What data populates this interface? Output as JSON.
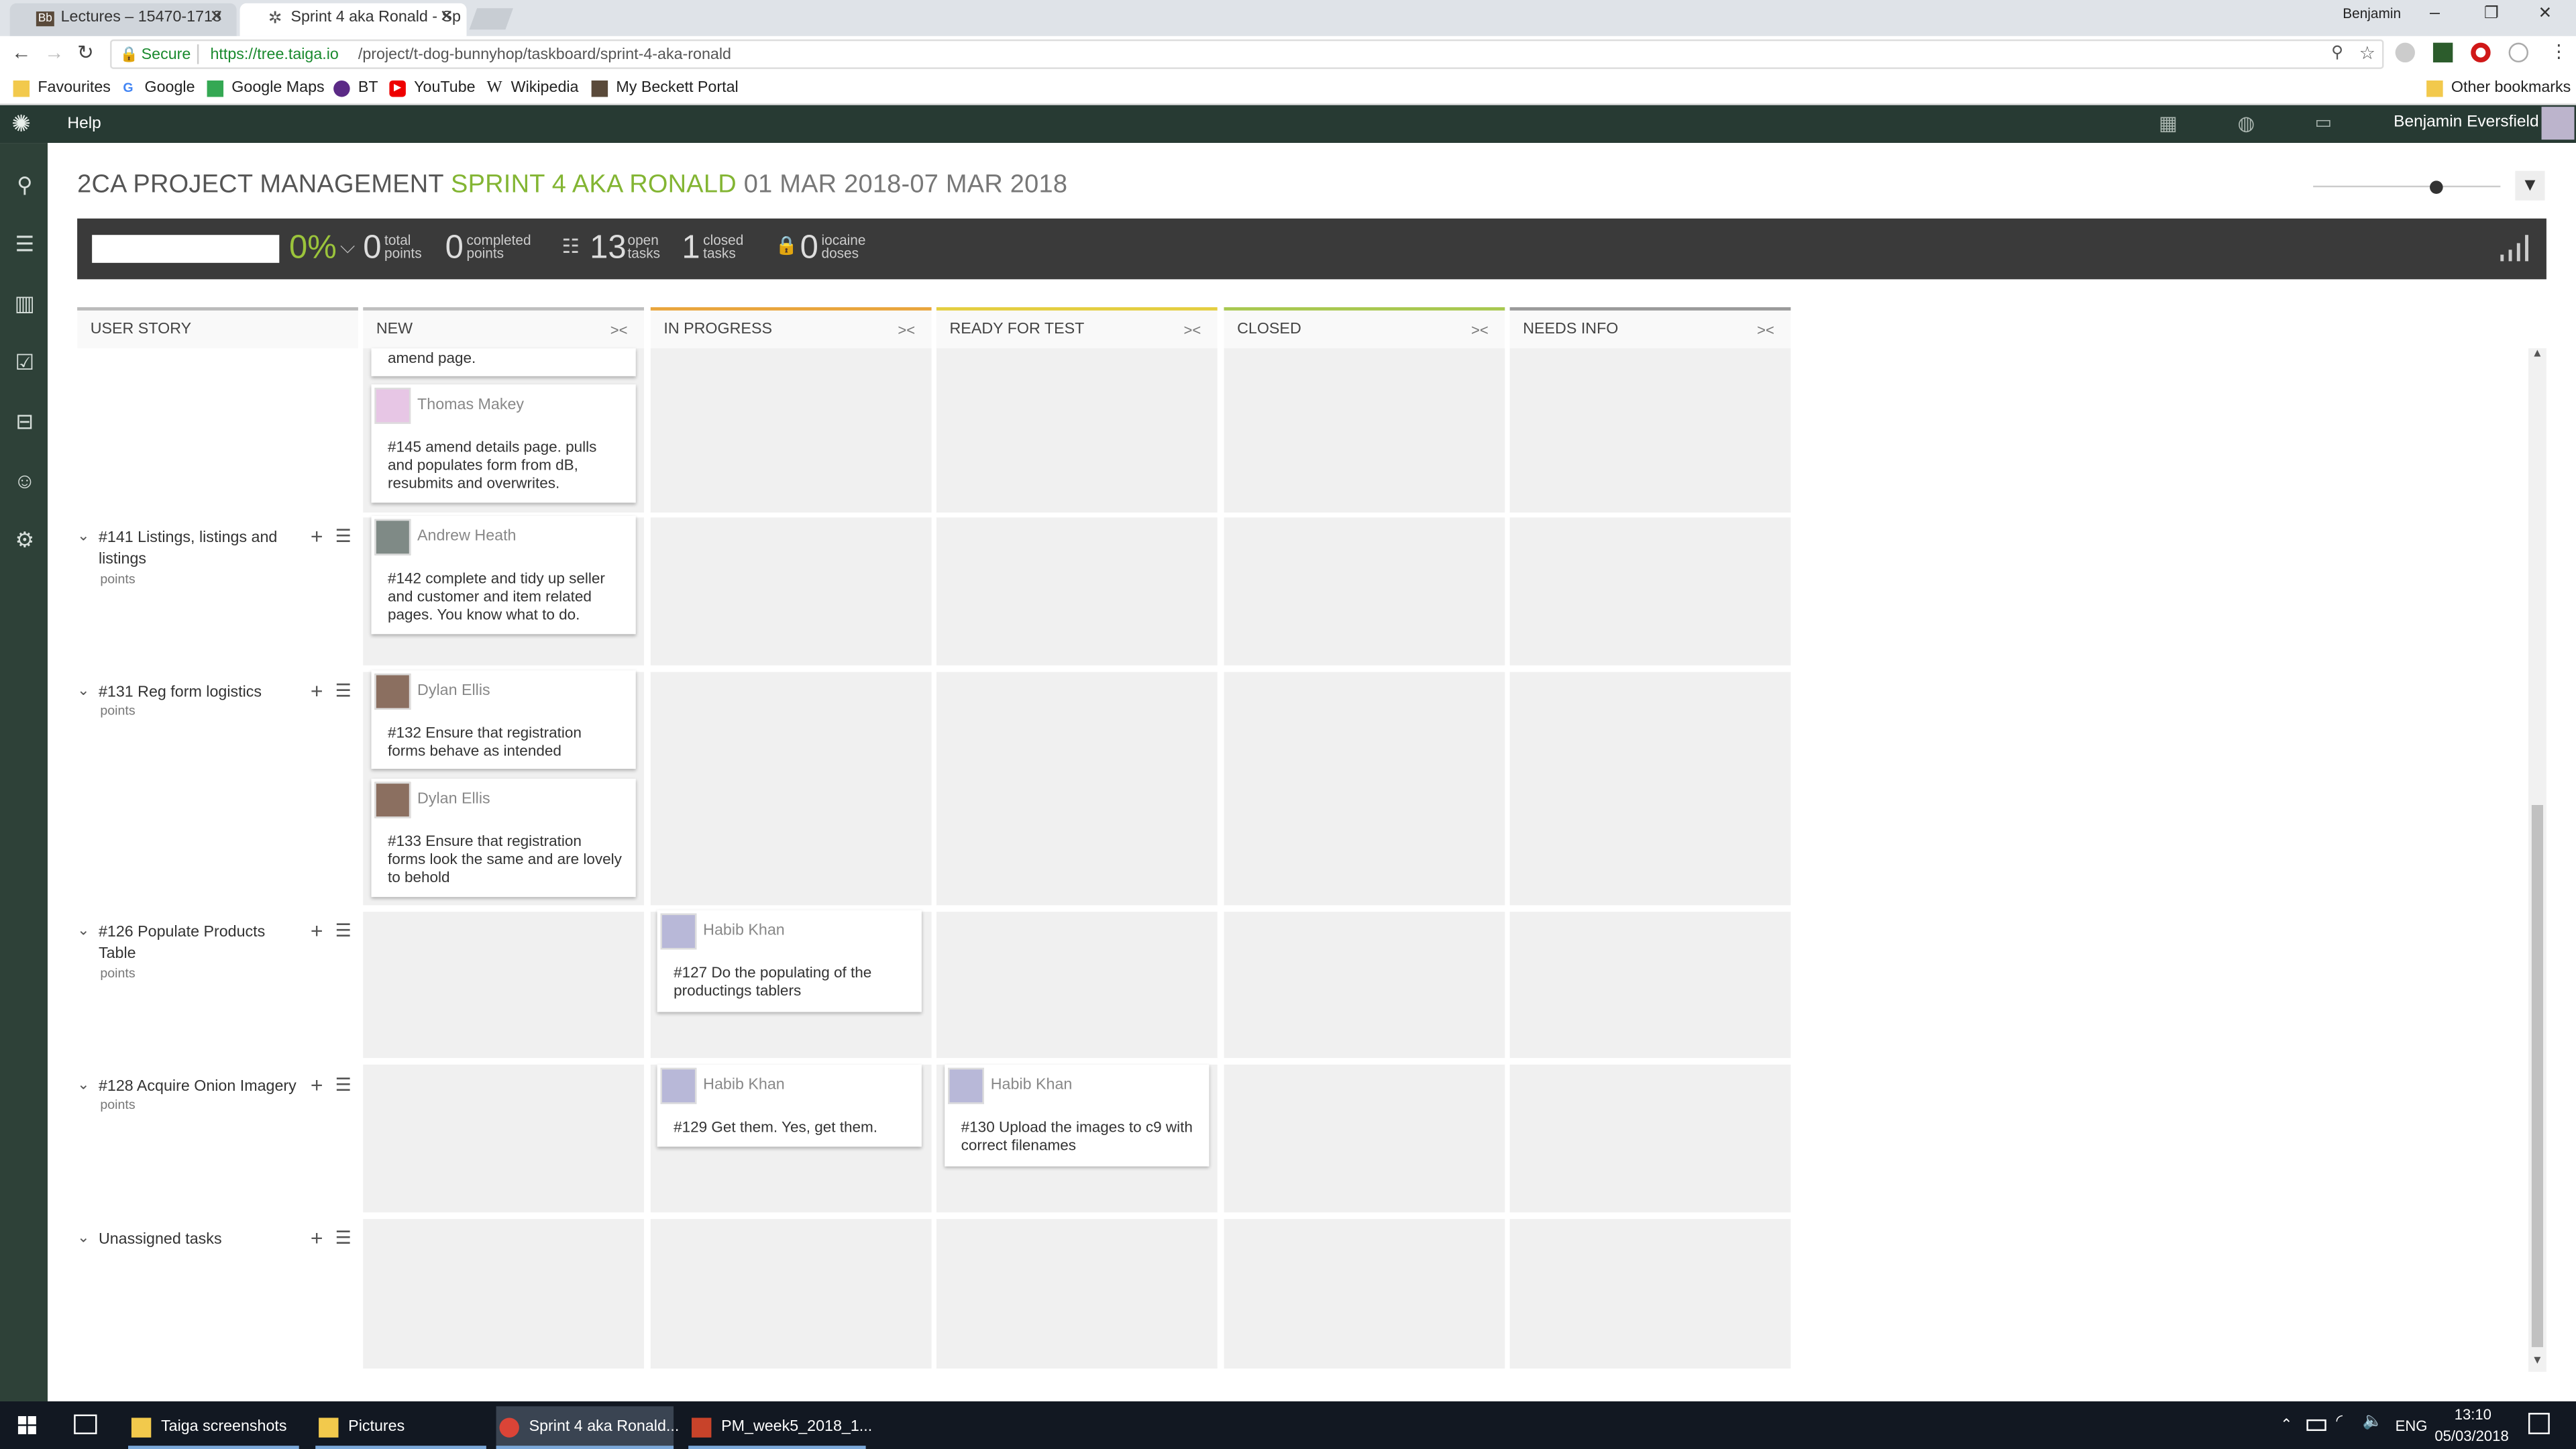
{
  "browser": {
    "tabs": [
      {
        "title": "Lectures – 15470-1718",
        "favicon_text": "Bb"
      },
      {
        "title": "Sprint 4 aka Ronald - Sp",
        "favicon_text": "✲"
      }
    ],
    "profile": "Benjamin",
    "secure_label": "Secure",
    "url_host": "https://tree.taiga.io",
    "url_path": "/project/t-dog-bunnyhop/taskboard/sprint-4-aka-ronald",
    "bookmarks": [
      "Favourites",
      "Google",
      "Google Maps",
      "BT",
      "YouTube",
      "Wikipedia",
      "My Beckett Portal"
    ],
    "other_bookmarks": "Other bookmarks"
  },
  "taiga_nav": {
    "help": "Help",
    "user_name": "Benjamin Eversfield"
  },
  "header": {
    "project": "2CA PROJECT MANAGEMENT",
    "sprint": "SPRINT 4 AKA RONALD",
    "dates": "01 MAR 2018-07 MAR 2018"
  },
  "stats": {
    "percent": "0%",
    "total_points_value": "0",
    "total_points_label_1": "total",
    "total_points_label_2": "points",
    "completed_points_value": "0",
    "completed_points_label_1": "completed",
    "completed_points_label_2": "points",
    "open_tasks_value": "13",
    "open_tasks_label_1": "open",
    "open_tasks_label_2": "tasks",
    "closed_tasks_value": "1",
    "closed_tasks_label_1": "closed",
    "closed_tasks_label_2": "tasks",
    "iocaine_value": "0",
    "iocaine_label_1": "iocaine",
    "iocaine_label_2": "doses"
  },
  "columns": {
    "user_story": "USER STORY",
    "new": "NEW",
    "in_progress": "IN PROGRESS",
    "ready_for_test": "READY FOR TEST",
    "closed": "CLOSED",
    "needs_info": "NEEDS INFO",
    "colors": {
      "new": "#bfbfbf",
      "in_progress": "#e9a53d",
      "ready_for_test": "#e4ce40",
      "closed": "#a8c850",
      "needs_info": "#9a9a9a"
    }
  },
  "stories": [
    {
      "title": "#141 Listings, listings and listings",
      "points": "points"
    },
    {
      "title": "#131 Reg form logistics",
      "points": "points"
    },
    {
      "title": "#126 Populate Products Table",
      "points": "points"
    },
    {
      "title": "#128 Acquire Onion Imagery",
      "points": "points"
    },
    {
      "title": "Unassigned tasks"
    }
  ],
  "cards": {
    "partial_text": "amend page.",
    "c145": {
      "assignee": "Thomas Makey",
      "text": "#145 amend details page. pulls and populates form from dB, resubmits and overwrites."
    },
    "c142": {
      "assignee": "Andrew Heath",
      "text": "#142 complete and tidy up seller and customer and item related pages. You know what to do."
    },
    "c132": {
      "assignee": "Dylan Ellis",
      "text": "#132 Ensure that registration forms behave as intended"
    },
    "c133": {
      "assignee": "Dylan Ellis",
      "text": "#133 Ensure that registration forms look the same and are lovely to behold"
    },
    "c127": {
      "assignee": "Habib Khan",
      "text": "#127 Do the populating of the productings tablers"
    },
    "c129": {
      "assignee": "Habib Khan",
      "text": "#129 Get them. Yes, get them."
    },
    "c130": {
      "assignee": "Habib Khan",
      "text": "#130 Upload the images to c9 with correct filenames"
    }
  },
  "taskbar": {
    "items": [
      "Taiga screenshots",
      "Pictures",
      "Sprint 4 aka Ronald...",
      "PM_week5_2018_1..."
    ],
    "lang": "ENG",
    "time": "13:10",
    "date": "05/03/2018"
  }
}
